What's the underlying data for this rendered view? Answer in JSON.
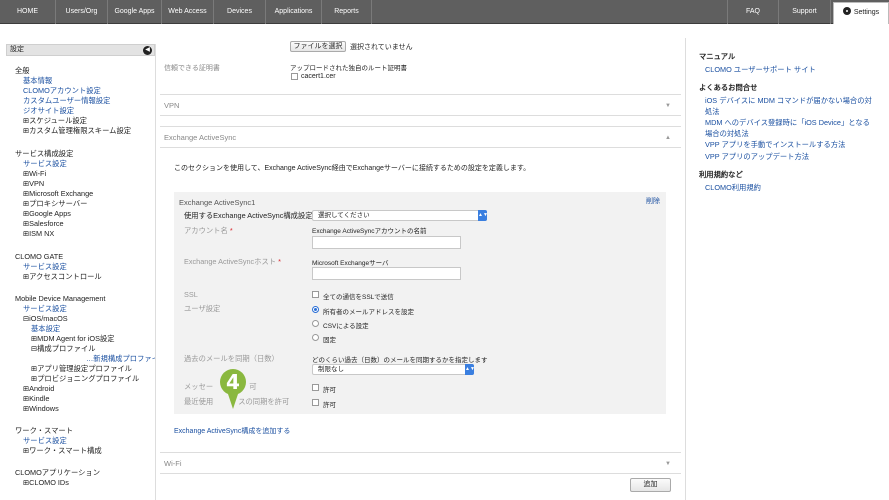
{
  "topnav": {
    "tabs": [
      "HOME",
      "Users/Org",
      "Google Apps",
      "Web Access",
      "Devices",
      "Applications",
      "Reports"
    ],
    "faq": "FAQ",
    "support": "Support",
    "settings": "Settings"
  },
  "sidebar": {
    "header": "設定",
    "collapse_icon": "chevron-left-icon",
    "lines": [
      {
        "text": "全般",
        "kind": "head"
      },
      {
        "text": "基本情報",
        "kind": "link"
      },
      {
        "text": "CLOMOアカウント設定",
        "kind": "link"
      },
      {
        "text": "カスタムユーザー情報設定",
        "kind": "link"
      },
      {
        "text": "ジオサイト設定",
        "kind": "link"
      },
      {
        "text": "⊞スケジュール設定",
        "kind": "head"
      },
      {
        "text": "⊞カスタム管理権限スキーム設定",
        "kind": "head"
      },
      {
        "text": "サービス構成設定",
        "kind": "head"
      },
      {
        "text": "サービス設定",
        "kind": "link"
      },
      {
        "text": "⊞Wi-Fi",
        "kind": "head"
      },
      {
        "text": "⊞VPN",
        "kind": "head"
      },
      {
        "text": "⊞Microsoft Exchange",
        "kind": "head"
      },
      {
        "text": "⊞プロキシサーバー",
        "kind": "head"
      },
      {
        "text": "⊞Google Apps",
        "kind": "head"
      },
      {
        "text": "⊞Salesforce",
        "kind": "head"
      },
      {
        "text": "⊞ISM NX",
        "kind": "head"
      },
      {
        "text": "CLOMO GATE",
        "kind": "head"
      },
      {
        "text": "サービス設定",
        "kind": "link"
      },
      {
        "text": "⊞アクセスコントロール",
        "kind": "head"
      },
      {
        "text": "Mobile Device Management",
        "kind": "head"
      },
      {
        "text": "サービス設定",
        "kind": "link"
      },
      {
        "text": "⊟iOS/macOS",
        "kind": "head"
      },
      {
        "text": "基本設定",
        "kind": "link"
      },
      {
        "text": "⊞MDM Agent for iOS設定",
        "kind": "head"
      },
      {
        "text": "⊟構成プロファイル",
        "kind": "head"
      },
      {
        "text": "…新規構成プロファイルを作成",
        "kind": "link"
      },
      {
        "text": "⊞アプリ管理設定プロファイル",
        "kind": "head"
      },
      {
        "text": "⊞プロビジョニングプロファイル",
        "kind": "head"
      },
      {
        "text": "⊞Android",
        "kind": "head"
      },
      {
        "text": "⊞Kindle",
        "kind": "head"
      },
      {
        "text": "⊞Windows",
        "kind": "head"
      },
      {
        "text": "ワーク・スマート",
        "kind": "head"
      },
      {
        "text": "サービス設定",
        "kind": "link"
      },
      {
        "text": "⊞ワーク・スマート構成",
        "kind": "head"
      },
      {
        "text": "CLOMOアプリケーション",
        "kind": "head"
      },
      {
        "text": "⊞CLOMO IDs",
        "kind": "head"
      }
    ]
  },
  "main": {
    "file_button": "ファイルを選択",
    "file_status": "選択されていません",
    "trusted_cert_label": "信頼できる証明書",
    "uploaded_root_cert": "アップロードされた独自のルート証明書",
    "cert_file": "cacert1.cer",
    "vpn_section": "VPN",
    "eas_section": "Exchange ActiveSync",
    "eas_description": "このセクションを使用して、Exchange ActiveSync経由でExchangeサーバーに接続するための設定を定義します。",
    "eas_item_title": "Exchange ActiveSync1",
    "delete_link": "削除",
    "use_config_label": "使用するExchange ActiveSync構成設定",
    "use_config_select": "選択してください",
    "account_name_label": "アカウント名",
    "account_name_hint": "Exchange ActiveSyncアカウントの名前",
    "host_label": "Exchange ActiveSyncホスト",
    "host_hint": "Microsoft Exchangeサーバ",
    "required_mark": "*",
    "ssl_label": "SSL",
    "ssl_option": "全ての通信をSSLで送信",
    "user_setting_label": "ユーザ設定",
    "user_options": [
      "所有者のメールアドレスを設定",
      "CSVによる設定",
      "固定"
    ],
    "past_mail_label": "過去のメールを同期（日数）",
    "past_mail_hint": "どのくらい過去（日数）のメールを同期するかを指定します",
    "past_mail_select": "制限なし",
    "move_messages_label": "メッセー",
    "move_messages_label_tail": "可",
    "move_messages_option": "許可",
    "recent_sync_label": "最近使用",
    "recent_sync_label_tail": "スの同期を許可",
    "recent_sync_option": "許可",
    "add_eas_link": "Exchange ActiveSync構成を追加する",
    "step_badge": "4",
    "wifi_section": "Wi-Fi",
    "add_button": "追加"
  },
  "rside": {
    "manual_heading": "マニュアル",
    "manual_link": "CLOMO ユーザーサポート サイト",
    "faq_heading": "よくあるお問合せ",
    "faq_links": [
      "iOS デバイスに MDM コマンドが届かない場合の対",
      "処法",
      "MDM へのデバイス登録時に「iOS Device」となる",
      "場合の対処法",
      "VPP アプリを手動でインストールする方法",
      "VPP アプリのアップデート方法"
    ],
    "terms_heading": "利用規約など",
    "terms_link": "CLOMO利用規約"
  },
  "colors": {
    "nav_bg": "#5f5f5f",
    "link": "#1a4fa0",
    "badge": "#8ab83f",
    "required": "#d9262c",
    "select_accent": "#3a7fe0"
  }
}
